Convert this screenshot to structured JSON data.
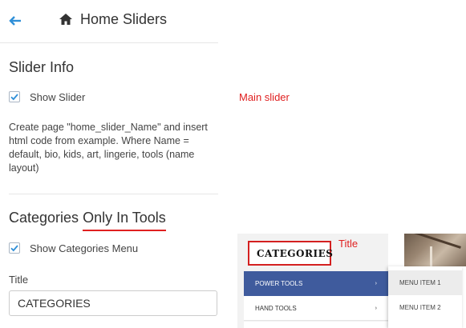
{
  "header": {
    "title": "Home Sliders",
    "back_icon": "arrow-left-icon",
    "home_icon": "home-icon"
  },
  "slider_info": {
    "heading": "Slider Info",
    "show_slider": {
      "label": "Show Slider",
      "checked": true
    },
    "description": "Create page \"home_slider_Name\" and insert html code from example. Where Name = default, bio, kids, art, lingerie, tools (name layout)",
    "annotation": "Main slider"
  },
  "categories": {
    "heading_prefix": "Categories ",
    "heading_highlight": "Only In Tools",
    "show_menu": {
      "label": "Show Categories Menu",
      "checked": true
    },
    "title_field": {
      "label": "Title",
      "value": "CATEGORIES"
    }
  },
  "preview": {
    "box_title": "CATEGORIES",
    "title_annotation": "Title",
    "menu": [
      {
        "label": "POWER TOOLS",
        "arrow": "›"
      },
      {
        "label": "HAND TOOLS",
        "arrow": "›"
      }
    ],
    "submenu": [
      "MENU ITEM 1",
      "MENU ITEM 2"
    ]
  },
  "colors": {
    "accent": "#2f8fd8",
    "annotation_red": "#e02020",
    "menu_active": "#3f5b9d"
  }
}
